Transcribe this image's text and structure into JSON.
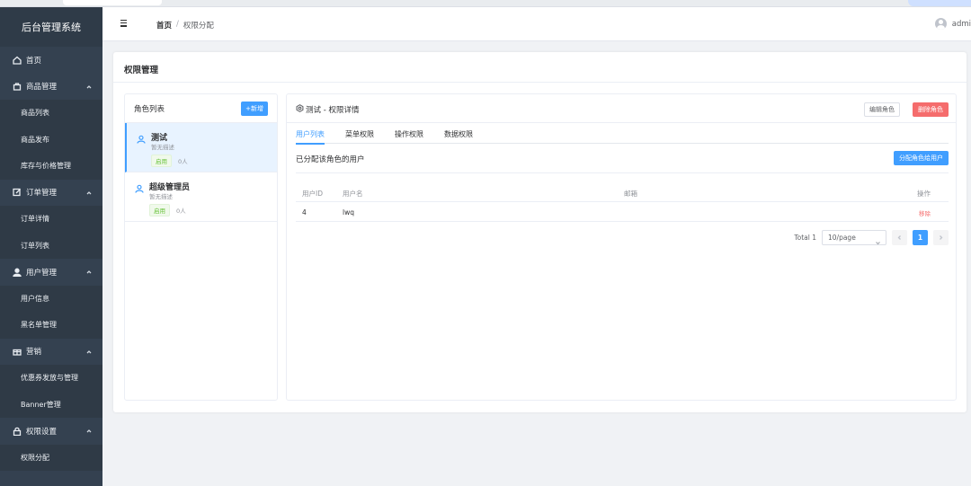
{
  "app": {
    "title": "后台管理系统"
  },
  "sidebar": {
    "items": [
      {
        "type": "item",
        "label": "首页",
        "icon": "home-icon"
      },
      {
        "type": "group",
        "label": "商品管理",
        "icon": "bag-icon"
      },
      {
        "type": "sub",
        "label": "商品列表"
      },
      {
        "type": "sub",
        "label": "商品发布"
      },
      {
        "type": "sub",
        "label": "库存与价格管理"
      },
      {
        "type": "group",
        "label": "订单管理",
        "icon": "edit-icon"
      },
      {
        "type": "sub",
        "label": "订单详情"
      },
      {
        "type": "sub",
        "label": "订单列表"
      },
      {
        "type": "group",
        "label": "用户管理",
        "icon": "user-icon"
      },
      {
        "type": "sub",
        "label": "用户信息"
      },
      {
        "type": "sub",
        "label": "黑名单管理"
      },
      {
        "type": "group",
        "label": "营销",
        "icon": "gift-icon"
      },
      {
        "type": "sub",
        "label": "优惠券发放与管理"
      },
      {
        "type": "sub",
        "label": "Banner管理"
      },
      {
        "type": "group",
        "label": "权限设置",
        "icon": "lock-icon"
      },
      {
        "type": "sub",
        "label": "权限分配"
      }
    ]
  },
  "header": {
    "breadcrumb": {
      "home": "首页",
      "separator": "/",
      "current": "权限分配"
    },
    "user": "admi"
  },
  "page": {
    "title": "权限管理"
  },
  "roles": {
    "title": "角色列表",
    "add_label": "+新增",
    "items": [
      {
        "name": "测试",
        "desc": "暂无描述",
        "status": "启用",
        "count": "0人",
        "active": true
      },
      {
        "name": "超级管理员",
        "desc": "暂无描述",
        "status": "启用",
        "count": "0人",
        "active": false
      }
    ]
  },
  "detail": {
    "title": "测试 - 权限详情",
    "edit_label": "编辑角色",
    "delete_label": "删除角色",
    "tabs": [
      "用户列表",
      "菜单权限",
      "操作权限",
      "数据权限"
    ],
    "active_tab": 0,
    "subtitle": "已分配该角色的用户",
    "assign_label": "分配角色给用户",
    "table": {
      "columns": [
        "用户ID",
        "用户名",
        "邮箱",
        "操作"
      ],
      "rows": [
        {
          "id": "4",
          "name": "lwq",
          "email": "",
          "op": "移除"
        }
      ]
    },
    "pagination": {
      "total": "Total 1",
      "page_size": "10/page",
      "current": "1"
    }
  },
  "colors": {
    "primary": "#409eff",
    "danger": "#f56c6c",
    "success": "#67c23a",
    "sidebar": "#344150"
  }
}
